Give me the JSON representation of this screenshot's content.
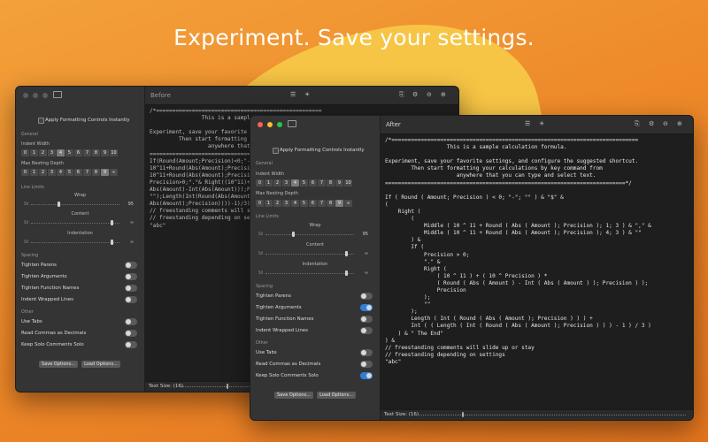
{
  "headline": "Experiment. Save your settings.",
  "colors": {
    "toggle_on": "#2f7fd8",
    "accent_blob": "#f7c545"
  },
  "before": {
    "editor_title": "Before",
    "status_text": "Text Size: (16)",
    "code_lines": [
      "/*===================================================",
      "                This is a sample calculation formula.",
      "",
      "Experiment, save your favorite settings, and configure",
      "         Then start formatting your calculations",
      "                  anywhere that you can type",
      "====================================================",
      "If(Round(Amount;Precision)<0;\"-\";\"\")&\"$\"&",
      "10^11+Round(Abs(Amount);Precision);1;3)&\",\"&",
      "10^11+Round(Abs(Amount);Precision);4;3)&\"\"",
      "Precision>0;\".\"& Right((10^11)+(10^Precision)*",
      "Abs(Amount)-Int(Abs(Amount)));Precision));",
      "\"\");Length(Int(Round(Abs(Amount);Precision)))",
      "Abs(Amount);Precision))))-1)/3)&\" The End\"",
      "// freestanding comments will slide up or stay",
      "// freestanding depending on settings",
      "\"abc\""
    ]
  },
  "after": {
    "editor_title": "After",
    "status_text": "Text Size: (16)",
    "code_lines": [
      "/*============================================================================",
      "                   This is a sample calculation formula.",
      "",
      "Experiment, save your favorite settings, and configure the suggested shortcut.",
      "        Then start formatting your calculations by key command from",
      "                      anywhere that you can type and select text.",
      "==========================================================================*/",
      "",
      "If ( Round ( Amount; Precision ) < 0; \"-\"; \"\" ) & \"$\" &",
      "(",
      "    Right (",
      "        (",
      "            Middle ( 10 ^ 11 + Round ( Abs ( Amount ); Precision ); 1; 3 ) & \",\" &",
      "            Middle ( 10 ^ 11 + Round ( Abs ( Amount ); Precision ); 4; 3 ) & \"\"",
      "        ) &",
      "        If (",
      "            Precision > 0;",
      "            \".\" &",
      "            Right (",
      "                ( 10 ^ 11 ) + ( 10 ^ Precision ) *",
      "                ( Round ( Abs ( Amount ) - Int ( Abs ( Amount ) ); Precision ) );",
      "                Precision",
      "            );",
      "            \"\"",
      "        );",
      "        Length ( Int ( Round ( Abs ( Amount ); Precision ) ) ) +",
      "        Int ( ( Length ( Int ( Round ( Abs ( Amount ); Precision ) ) ) - 1 ) / 3 )",
      "    ) & \" The End\"",
      ") &",
      "// freestanding comments will slide up or stay",
      "// freestanding depending on settings",
      "\"abc\""
    ]
  },
  "controls": {
    "apply_label": "Apply Formatting Controls Instantly",
    "general_label": "General",
    "indent_width_label": "Indent Width",
    "indent_width_options": [
      "0",
      "1",
      "2",
      "3",
      "4",
      "5",
      "6",
      "7",
      "8",
      "9",
      "10"
    ],
    "indent_width_selected": "4",
    "max_nesting_label": "Max Nesting Depth",
    "max_nesting_options": [
      "0",
      "1",
      "2",
      "3",
      "4",
      "5",
      "6",
      "7",
      "8",
      "9",
      "∞"
    ],
    "max_nesting_selected": "9",
    "line_limits_label": "Line Limits",
    "wrap_label": "Wrap",
    "wrap_min": "50",
    "wrap_value": "95",
    "wrap_fraction": 0.3,
    "content_label": "Content",
    "content_min": "50",
    "content_value": "∞",
    "indentation_label": "Indentation",
    "indentation_min": "50",
    "indentation_value": "∞",
    "spacing_label": "Spacing",
    "tighten_parens": "Tighten Parens",
    "tighten_arguments": "Tighten Arguments",
    "tighten_function_names": "Tighten Function Names",
    "indent_wrapped_lines": "Indent Wrapped Lines",
    "other_label": "Other",
    "use_tabs": "Use Tabs",
    "read_commas": "Read Commas as Decimals",
    "keep_solo": "Keep Solo Comments Solo",
    "save_options": "Save Options...",
    "load_options": "Load Options..."
  }
}
